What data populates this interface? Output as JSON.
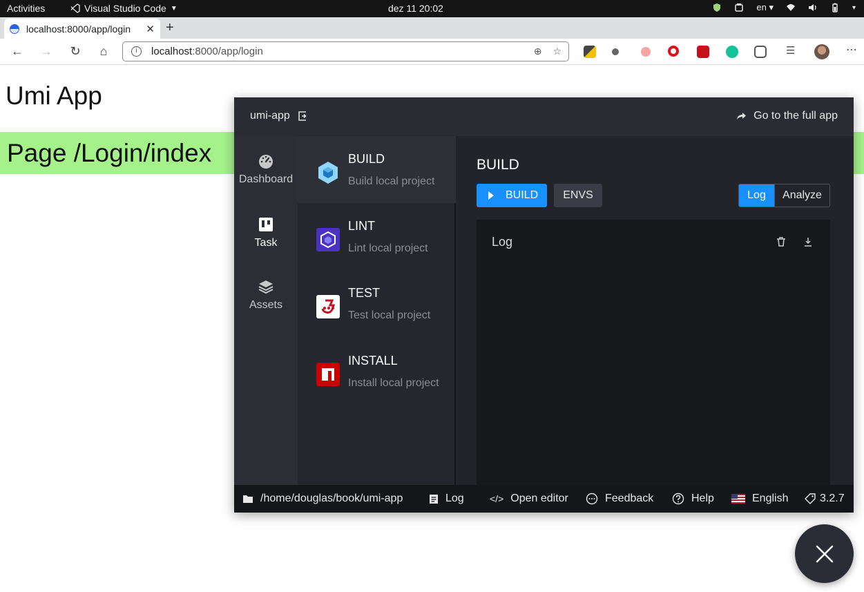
{
  "system_bar": {
    "activities": "Activities",
    "app_name": "Visual Studio Code",
    "clock": "dez 11  20:02",
    "language": "en"
  },
  "browser": {
    "tab_title": "localhost:8000/app/login",
    "url_host": "localhost",
    "url_path": ":8000/app/login"
  },
  "page": {
    "title": "Umi App",
    "banner": "Page /Login/index"
  },
  "umi": {
    "project_name": "umi-app",
    "full_app_link": "Go to the full app",
    "nav": [
      {
        "label": "Dashboard",
        "icon": "dashboard-icon"
      },
      {
        "label": "Task",
        "icon": "task-icon"
      },
      {
        "label": "Assets",
        "icon": "layers-icon"
      }
    ],
    "tasks": [
      {
        "title": "BUILD",
        "desc": "Build local project",
        "icon": "webpack-icon"
      },
      {
        "title": "LINT",
        "desc": "Lint local project",
        "icon": "eslint-icon"
      },
      {
        "title": "TEST",
        "desc": "Test local project",
        "icon": "jest-icon"
      },
      {
        "title": "INSTALL",
        "desc": "Install local project",
        "icon": "npm-icon"
      }
    ],
    "detail": {
      "title": "BUILD",
      "build_button": "BUILD",
      "envs_button": "ENVS",
      "seg_log": "Log",
      "seg_analyze": "Analyze",
      "log_title": "Log"
    },
    "footer": {
      "path": "/home/douglas/book/umi-app",
      "log": "Log",
      "open_editor": "Open editor",
      "feedback": "Feedback",
      "help": "Help",
      "language": "English",
      "version": "3.2.7"
    }
  },
  "colors": {
    "primary": "#1890ff",
    "banner": "#a6f28a",
    "panel": "#23242a"
  }
}
